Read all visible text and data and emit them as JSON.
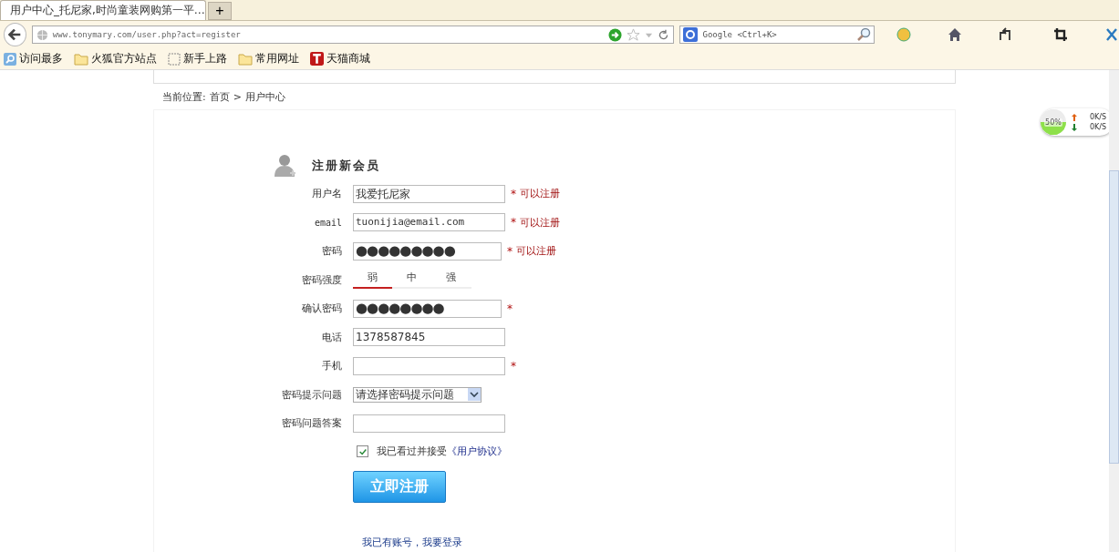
{
  "browser": {
    "tabs": [
      {
        "title": "用户中心_托尼家,时尚童装网购第一平…",
        "selected": true
      }
    ],
    "new_tab": "+",
    "address": "www.tonymary.com/user.php?act=register",
    "search_placeholder": "Google <Ctrl+K>",
    "bookmarks": [
      {
        "label": "访问最多",
        "kind": "search"
      },
      {
        "label": "火狐官方站点",
        "kind": "folder"
      },
      {
        "label": "新手上路",
        "kind": "page"
      },
      {
        "label": "常用网址",
        "kind": "folder"
      },
      {
        "label": "天猫商城",
        "kind": "brand"
      }
    ]
  },
  "breadcrumb": {
    "prefix": "当前位置:",
    "items": [
      "首页",
      "用户中心"
    ],
    "separator": ">"
  },
  "form": {
    "title": "注册新会员",
    "fields": [
      {
        "kind": "text",
        "label": "用户名",
        "value": "我爱托尼家",
        "required": true,
        "status": "可以注册"
      },
      {
        "kind": "text",
        "label": "email",
        "value": "tuonijia@email.com",
        "required": true,
        "status": "可以注册"
      },
      {
        "kind": "password",
        "label": "密码",
        "value": "●●●●●●●●●",
        "required": true,
        "status": "可以注册"
      },
      {
        "kind": "strength",
        "label": "密码强度",
        "levels": [
          {
            "label": "弱",
            "selected": true
          },
          {
            "label": "中",
            "selected": false
          },
          {
            "label": "强",
            "selected": false
          }
        ]
      },
      {
        "kind": "password",
        "label": "确认密码",
        "value": "●●●●●●●●",
        "required": true
      },
      {
        "kind": "text",
        "label": "电话",
        "value": "1378587845",
        "required": false
      },
      {
        "kind": "text",
        "label": "手机",
        "required": true
      },
      {
        "kind": "select",
        "label": "密码提示问题",
        "value": "请选择密码提示问题"
      },
      {
        "kind": "text",
        "label": "密码问题答案",
        "required": false
      }
    ],
    "required_mark": "*",
    "agreement": {
      "checked": true,
      "text": "我已看过并接受",
      "link": "《用户协议》"
    },
    "submit": "立即注册",
    "login_link": "我已有账号，我要登录"
  },
  "net_widget": {
    "percent": "50%",
    "level": 0.5,
    "up": "0K/S",
    "down": "0K/S"
  }
}
